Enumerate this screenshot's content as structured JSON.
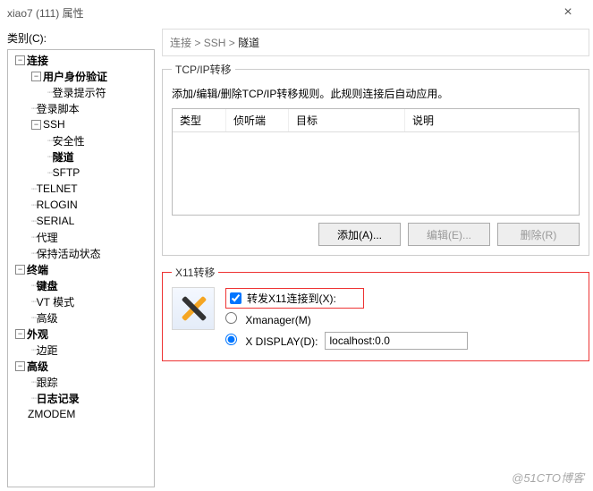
{
  "window": {
    "title": "xiao7  (111)  属性",
    "close": "×"
  },
  "category_label": "类别(C):",
  "tree": {
    "conn": "连接",
    "auth": "用户身份验证",
    "login_prompt": "登录提示符",
    "login_script": "登录脚本",
    "ssh": "SSH",
    "security": "安全性",
    "tunnel": "隧道",
    "sftp": "SFTP",
    "telnet": "TELNET",
    "rlogin": "RLOGIN",
    "serial": "SERIAL",
    "proxy": "代理",
    "keepalive": "保持活动状态",
    "terminal": "终端",
    "keyboard": "键盘",
    "vtmode": "VT 模式",
    "advanced_t": "高级",
    "appearance": "外观",
    "margin": "边距",
    "adv": "高级",
    "trace": "跟踪",
    "logging": "日志记录",
    "zmodem": "ZMODEM"
  },
  "breadcrumb": {
    "a": "连接",
    "sep": " > ",
    "b": "SSH",
    "c": "隧道"
  },
  "tcpip": {
    "legend": "TCP/IP转移",
    "desc": "添加/编辑/删除TCP/IP转移规则。此规则连接后自动应用。",
    "cols": {
      "type": "类型",
      "listen": "侦听端",
      "target": "目标",
      "desc": "说明"
    },
    "add": "添加(A)...",
    "edit": "编辑(E)...",
    "del": "删除(R)"
  },
  "x11": {
    "legend": "X11转移",
    "forward": "转发X11连接到(X):",
    "xmanager": "Xmanager(M)",
    "xdisplay": "X DISPLAY(D):",
    "display_value": "localhost:0.0"
  },
  "watermark": "@51CTO博客"
}
